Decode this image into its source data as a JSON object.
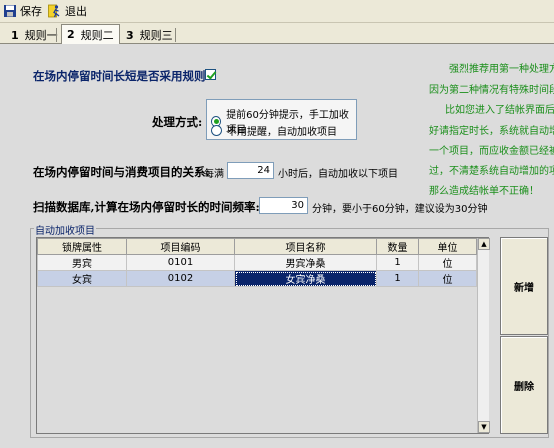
{
  "toolbar": {
    "save_label": "保存",
    "exit_label": "退出"
  },
  "tabs": [
    {
      "num": "1",
      "label": "规则一"
    },
    {
      "num": "2",
      "label": "规则二"
    },
    {
      "num": "3",
      "label": "规则三"
    }
  ],
  "active_tab": 1,
  "rule_short_stay": {
    "label": "在场内停留时间长短是否采用规则:",
    "checked": true
  },
  "handling": {
    "label": "处理方式:",
    "options": [
      "提前60分钟提示，手工加收项目",
      "不用提醒，自动加收项目"
    ],
    "selected_index": 0
  },
  "relation": {
    "label": "在场内停留时间与消费项目的关系:",
    "prefix": "每满",
    "value": "24",
    "suffix": "小时后，自动加收以下项目"
  },
  "scan": {
    "label": "扫描数据库,计算在场内停留时长的时间频率:",
    "value": "30",
    "suffix": "分钟，要小于60分钟，建议设为30分钟"
  },
  "note_lines": [
    "强烈推荐用第一种处理方式",
    "因为第二种情况有特殊时间段：",
    "比如您进入了结帐界面后，",
    "好请指定时长，系统就自动增加",
    "一个项目，而应收金额已经被计",
    "过，不清楚系统自动增加的项目",
    "那么造成结帐单不正确！"
  ],
  "auto_items": {
    "group_title": "自动加收项目",
    "columns": [
      "锁牌属性",
      "项目编码",
      "项目名称",
      "数量",
      "单位"
    ],
    "rows": [
      [
        "男宾",
        "0101",
        "男宾净桑",
        "1",
        "位"
      ],
      [
        "女宾",
        "0102",
        "女宾净桑",
        "1",
        "位"
      ]
    ]
  },
  "buttons": {
    "add_label": "新增",
    "delete_label": "删除"
  },
  "colors": {
    "note_green": "#1b8f1b",
    "selection_navy": "#0a246a",
    "label_navy": "#0a246a"
  }
}
